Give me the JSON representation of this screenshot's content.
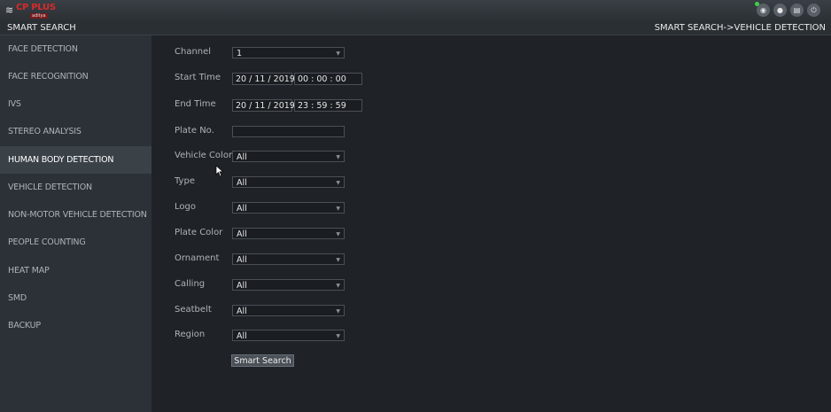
{
  "app": {
    "brand": "CP PLUS",
    "brand_sub": "aditya",
    "section_title": "SMART SEARCH",
    "breadcrumb": "SMART SEARCH->VEHICLE DETECTION"
  },
  "toolbar_icons": [
    "eye-icon",
    "user-icon",
    "menu-icon",
    "power-icon"
  ],
  "sidebar": {
    "items": [
      {
        "label": "FACE DETECTION"
      },
      {
        "label": "FACE RECOGNITION"
      },
      {
        "label": "IVS"
      },
      {
        "label": "STEREO ANALYSIS"
      },
      {
        "label": "HUMAN BODY DETECTION"
      },
      {
        "label": "VEHICLE DETECTION"
      },
      {
        "label": "NON-MOTOR VEHICLE DETECTION"
      },
      {
        "label": "PEOPLE COUNTING"
      },
      {
        "label": "HEAT MAP"
      },
      {
        "label": "SMD"
      },
      {
        "label": "BACKUP"
      }
    ],
    "active_index": 4
  },
  "form": {
    "channel": {
      "label": "Channel",
      "value": "1"
    },
    "start_time": {
      "label": "Start Time",
      "date": "20 / 11 / 2019",
      "time": "00 : 00 : 00"
    },
    "end_time": {
      "label": "End Time",
      "date": "20 / 11 / 2019",
      "time": "23 : 59 : 59"
    },
    "plate_no": {
      "label": "Plate No.",
      "value": ""
    },
    "vehicle_color": {
      "label": "Vehicle Color",
      "value": "All"
    },
    "type": {
      "label": "Type",
      "value": "All"
    },
    "logo": {
      "label": "Logo",
      "value": "All"
    },
    "plate_color": {
      "label": "Plate Color",
      "value": "All"
    },
    "ornament": {
      "label": "Ornament",
      "value": "All"
    },
    "calling": {
      "label": "Calling",
      "value": "All"
    },
    "seatbelt": {
      "label": "Seatbelt",
      "value": "All"
    },
    "region": {
      "label": "Region",
      "value": "All"
    },
    "search_button": "Smart Search"
  }
}
